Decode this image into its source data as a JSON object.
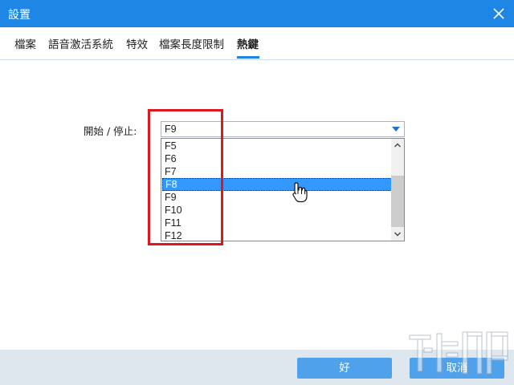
{
  "window": {
    "title": "設置"
  },
  "tabs": [
    {
      "label": "檔案"
    },
    {
      "label": "語音激活系統"
    },
    {
      "label": "特效"
    },
    {
      "label": "檔案長度限制"
    },
    {
      "label": "熱鍵",
      "active": true
    }
  ],
  "hotkey": {
    "label": "開始 / 停止:",
    "selected_value": "F9",
    "options": [
      "F5",
      "F6",
      "F7",
      "F8",
      "F9",
      "F10",
      "F11",
      "F12"
    ],
    "highlighted_option": "F8"
  },
  "footer": {
    "ok_label": "好",
    "cancel_label": "取消"
  },
  "colors": {
    "accent": "#1e86e4",
    "selection": "#3399ff",
    "annotation": "#e0161f",
    "button": "#4ea1ea"
  }
}
